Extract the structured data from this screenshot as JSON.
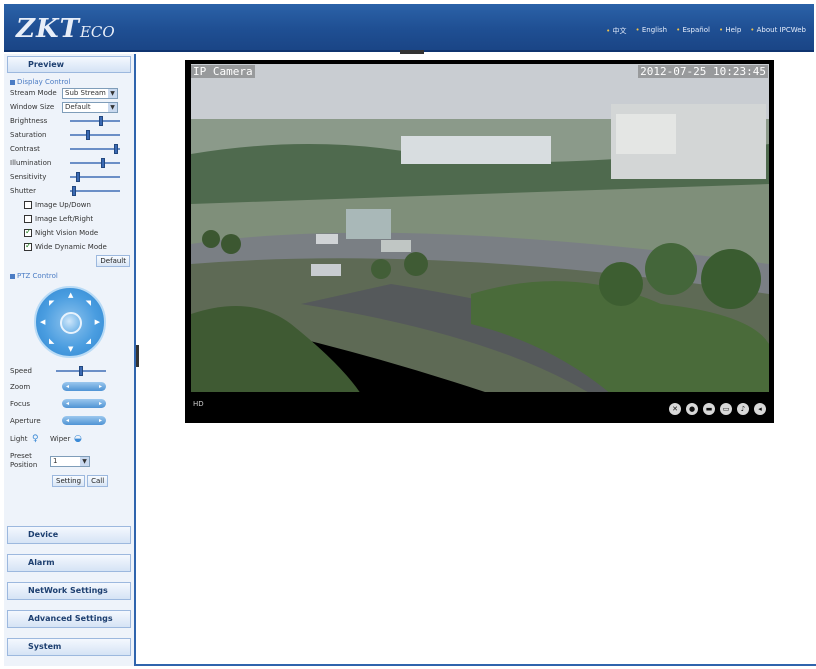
{
  "header": {
    "logo_main": "ZKT",
    "logo_eco": "ECO",
    "links": [
      "中文",
      "English",
      "Español",
      "Help",
      "About IPCWeb"
    ]
  },
  "sidebar": {
    "preview": "Preview",
    "display_control": "Display Control",
    "stream_mode_label": "Stream Mode",
    "stream_mode_value": "Sub Stream",
    "window_size_label": "Window Size",
    "window_size_value": "Default",
    "sliders": [
      {
        "label": "Brightness",
        "level": 0.62
      },
      {
        "label": "Saturation",
        "level": 0.35
      },
      {
        "label": "Contrast",
        "level": 0.95
      },
      {
        "label": "Illumination",
        "level": 0.68
      },
      {
        "label": "Sensitivity",
        "level": 0.12
      },
      {
        "label": "Shutter",
        "level": 0.05
      }
    ],
    "checks": [
      {
        "label": "Image Up/Down",
        "checked": false
      },
      {
        "label": "Image Left/Right",
        "checked": false
      },
      {
        "label": "Night Vision Mode",
        "checked": true
      },
      {
        "label": "Wide Dynamic Mode",
        "checked": true
      }
    ],
    "default_btn": "Default",
    "ptz_control": "PTZ Control",
    "speed_label": "Speed",
    "speed_level": 0.5,
    "zoom_label": "Zoom",
    "focus_label": "Focus",
    "aperture_label": "Aperture",
    "light_label": "Light",
    "wiper_label": "Wiper",
    "preset_label": "Preset Position",
    "preset_value": "1",
    "setting_btn": "Setting",
    "call_btn": "Call",
    "sections": [
      "Device",
      "Alarm",
      "NetWork Settings",
      "Advanced Settings",
      "System"
    ]
  },
  "video": {
    "label": "IP Camera",
    "timestamp": "2012-07-25 10:23:45",
    "quality": "HD"
  },
  "colors": {
    "accent": "#2b62a8",
    "header_dark": "#1a4586"
  }
}
